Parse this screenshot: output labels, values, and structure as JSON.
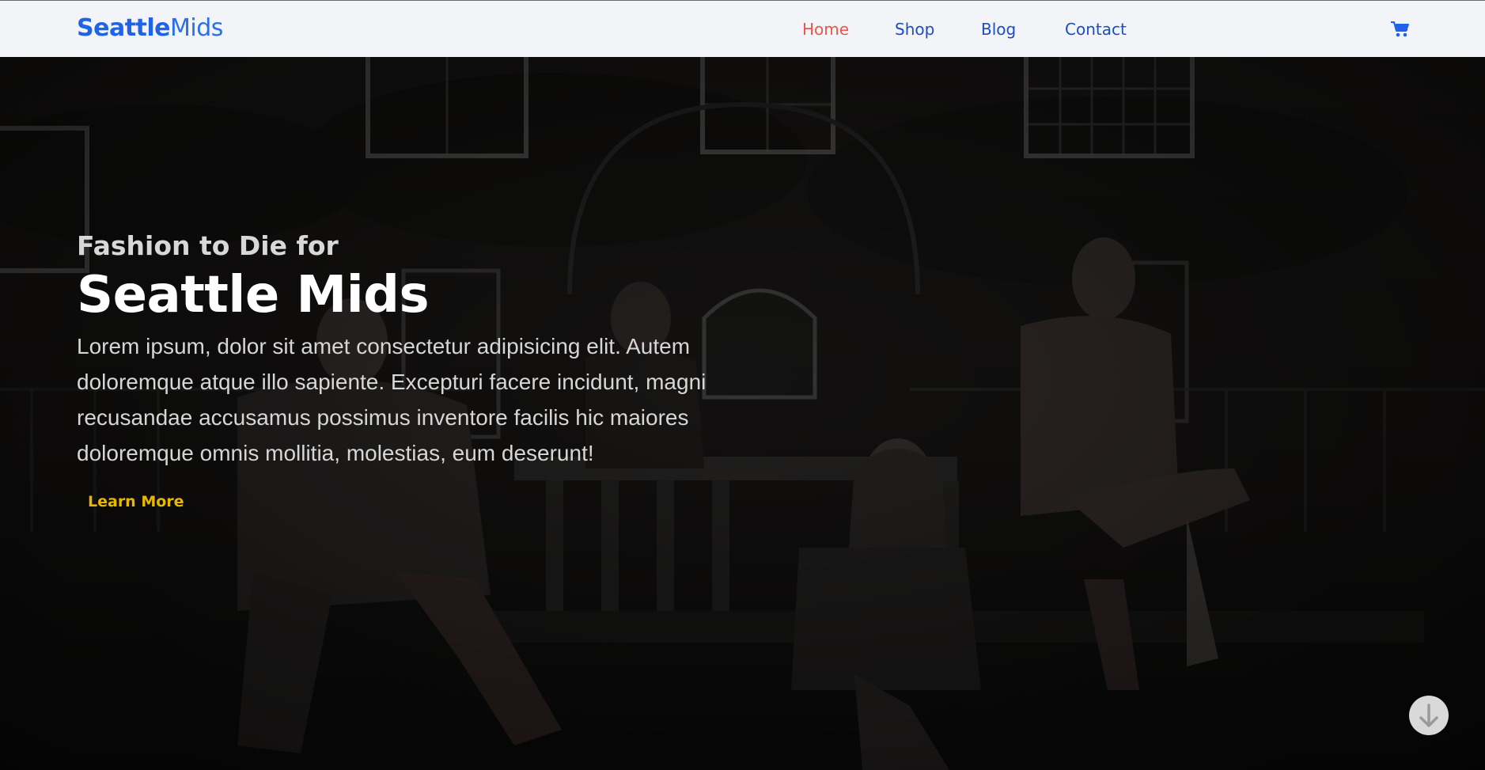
{
  "header": {
    "brand_bold": "Seattle",
    "brand_light": "Mids",
    "nav": [
      {
        "label": "Home",
        "active": true
      },
      {
        "label": "Shop",
        "active": false
      },
      {
        "label": "Blog",
        "active": false
      },
      {
        "label": "Contact",
        "active": false
      }
    ],
    "cart_icon": "shopping-cart-icon"
  },
  "hero": {
    "eyebrow": "Fashion to Die for",
    "title": "Seattle Mids",
    "text": "Lorem ipsum, dolor sit amet consectetur adipisicing elit. Autem doloremque atque illo sapiente. Excepturi facere incidunt, magni recusandae accusamus possimus inventore facilis hic maiores doloremque omnis mollitia, molestias, eum deserunt!",
    "button_label": "Learn More",
    "scroll_icon": "arrow-down-icon"
  },
  "colors": {
    "brand": "#1f63e8",
    "nav_link": "#1b4fbf",
    "nav_active": "#e8584a",
    "button_text": "#e8b800",
    "navbar_bg": "#f3f4f7"
  }
}
